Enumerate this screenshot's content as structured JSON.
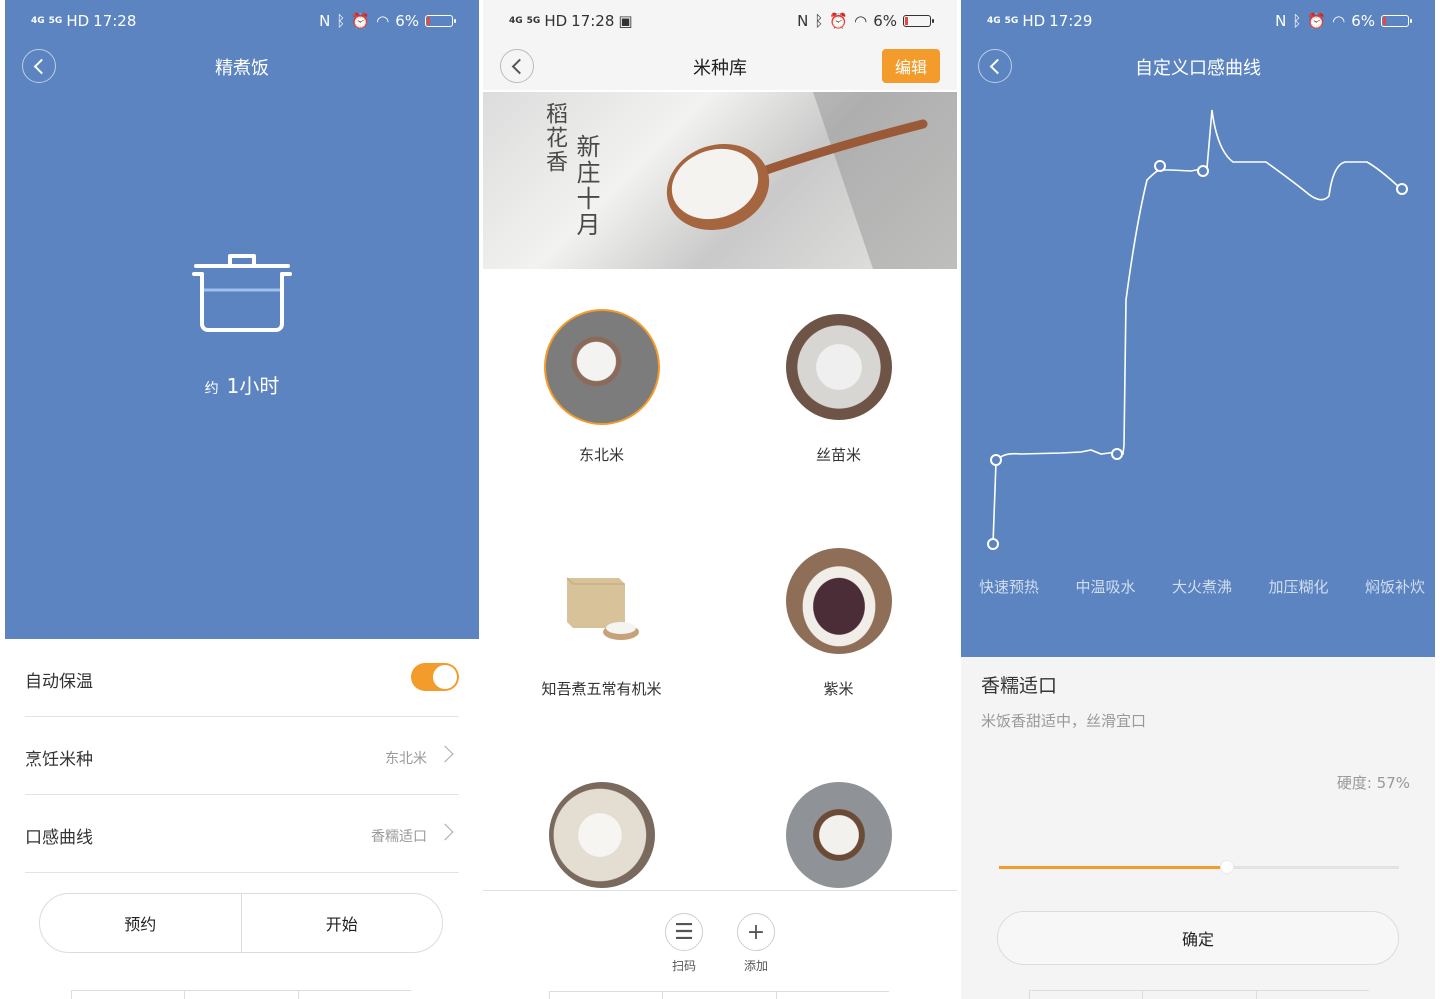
{
  "screen1": {
    "status": {
      "net": "4G",
      "net2": "5G",
      "hd": "HD",
      "time": "17:28",
      "battery": "6%"
    },
    "title": "精煮饭",
    "time_prefix": "约",
    "time_value": "1小时",
    "settings": [
      {
        "label": "自动保温",
        "toggle_on": true
      },
      {
        "label": "烹饪米种",
        "value": "东北米"
      },
      {
        "label": "口感曲线",
        "value": "香糯适口"
      }
    ],
    "buttons": {
      "reserve": "预约",
      "start": "开始"
    }
  },
  "screen2": {
    "status": {
      "net": "4G",
      "net2": "5G",
      "hd": "HD",
      "time": "17:28",
      "battery": "6%"
    },
    "title": "米种库",
    "edit_label": "编辑",
    "banner": {
      "line1": "稻花香",
      "line2": "新庄十月"
    },
    "rice_items": [
      {
        "name": "东北米",
        "selected": true
      },
      {
        "name": "丝苗米",
        "selected": false
      },
      {
        "name": "知吾煮五常有机米",
        "selected": false
      },
      {
        "name": "紫米",
        "selected": false
      },
      {
        "name": "",
        "selected": false
      },
      {
        "name": "",
        "selected": false
      }
    ],
    "tools": {
      "scan": "扫码",
      "add": "添加"
    }
  },
  "screen3": {
    "status": {
      "net": "4G",
      "net2": "5G",
      "hd": "HD",
      "time": "17:29",
      "battery": "6%"
    },
    "title": "自定义口感曲线",
    "stages": [
      "快速预热",
      "中温吸水",
      "大火煮沸",
      "加压糊化",
      "焖饭补炊"
    ],
    "taste_title": "香糯适口",
    "taste_desc": "米饭香甜适中，丝滑宜口",
    "hardness_label": "硬度: 57%",
    "hardness_value": 0.57,
    "confirm_label": "确定"
  },
  "colors": {
    "primary_blue": "#5b84c0",
    "accent_orange": "#f39c2c"
  }
}
